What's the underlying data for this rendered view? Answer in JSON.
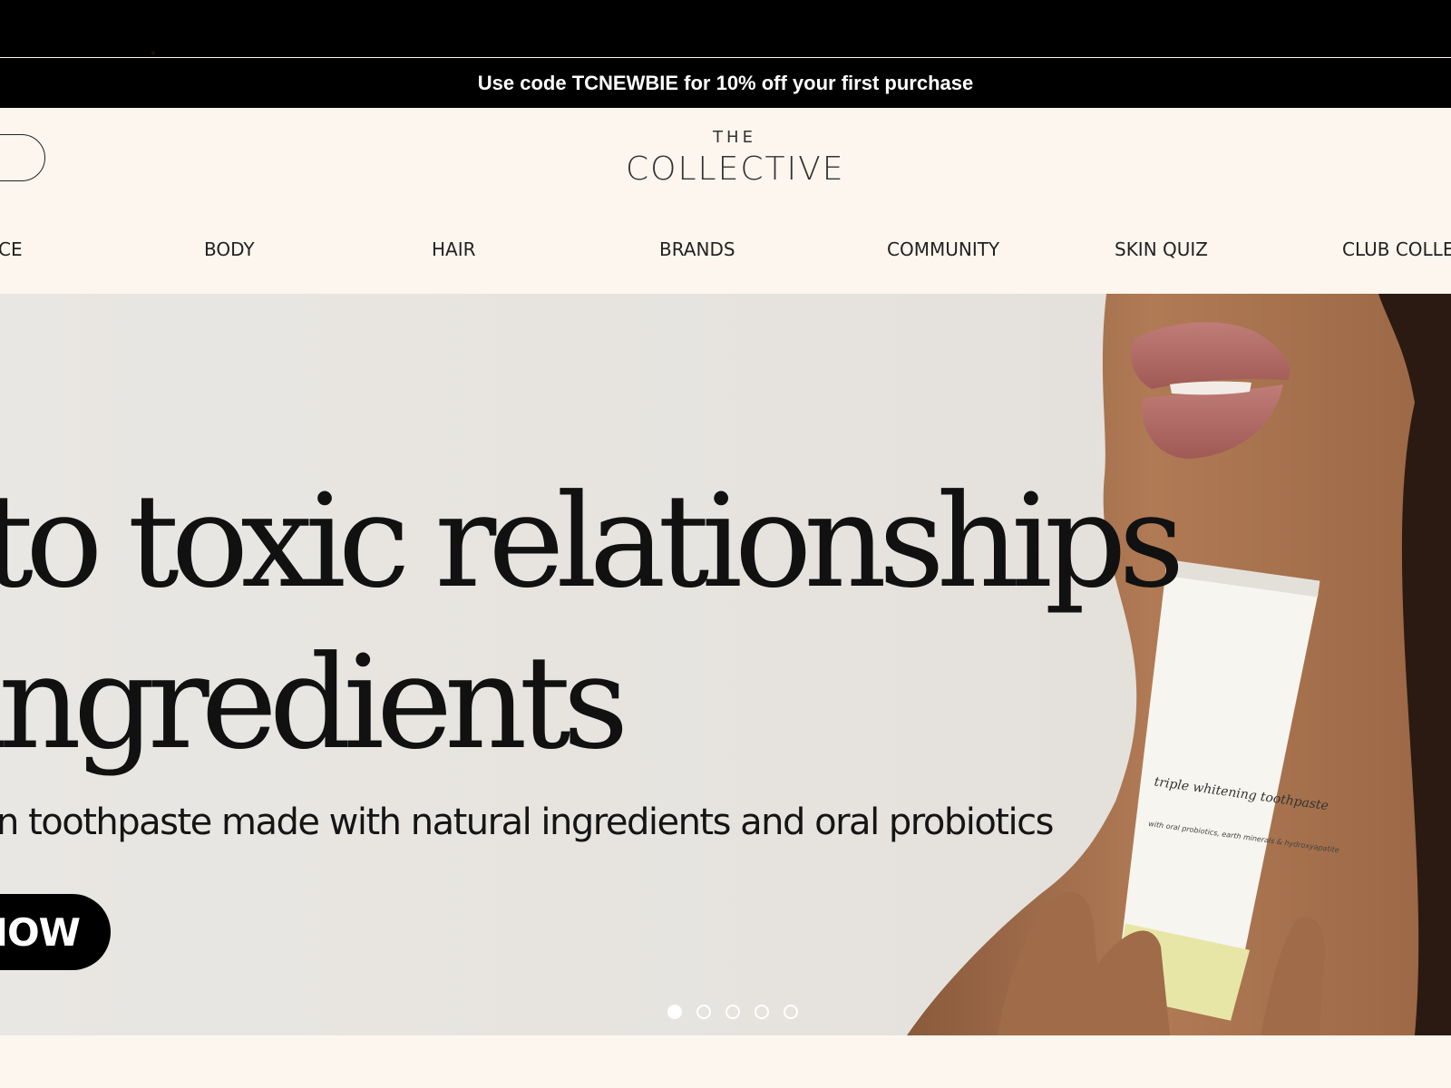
{
  "announcement": {
    "text": "Use code TCNEWBIE for 10% off your first purchase"
  },
  "header": {
    "logo_small": "THE",
    "logo_main": "COLLECTIVE"
  },
  "nav": {
    "items": [
      {
        "label": "CE"
      },
      {
        "label": "BODY"
      },
      {
        "label": "HAIR"
      },
      {
        "label": "BRANDS"
      },
      {
        "label": "COMMUNITY"
      },
      {
        "label": "SKIN QUIZ"
      },
      {
        "label": "CLUB COLLE"
      }
    ]
  },
  "hero": {
    "headline_line1": "to toxic relationships",
    "headline_line2": "ingredients",
    "subline": "n toothpaste made with natural ingredients and oral probiotics",
    "cta_label": "IOW",
    "product_label": "triple whitening toothpaste",
    "product_sub": "with oral probiotics, earth minerals & hydroxyapatite",
    "slides": {
      "count": 5,
      "active": 1
    }
  }
}
